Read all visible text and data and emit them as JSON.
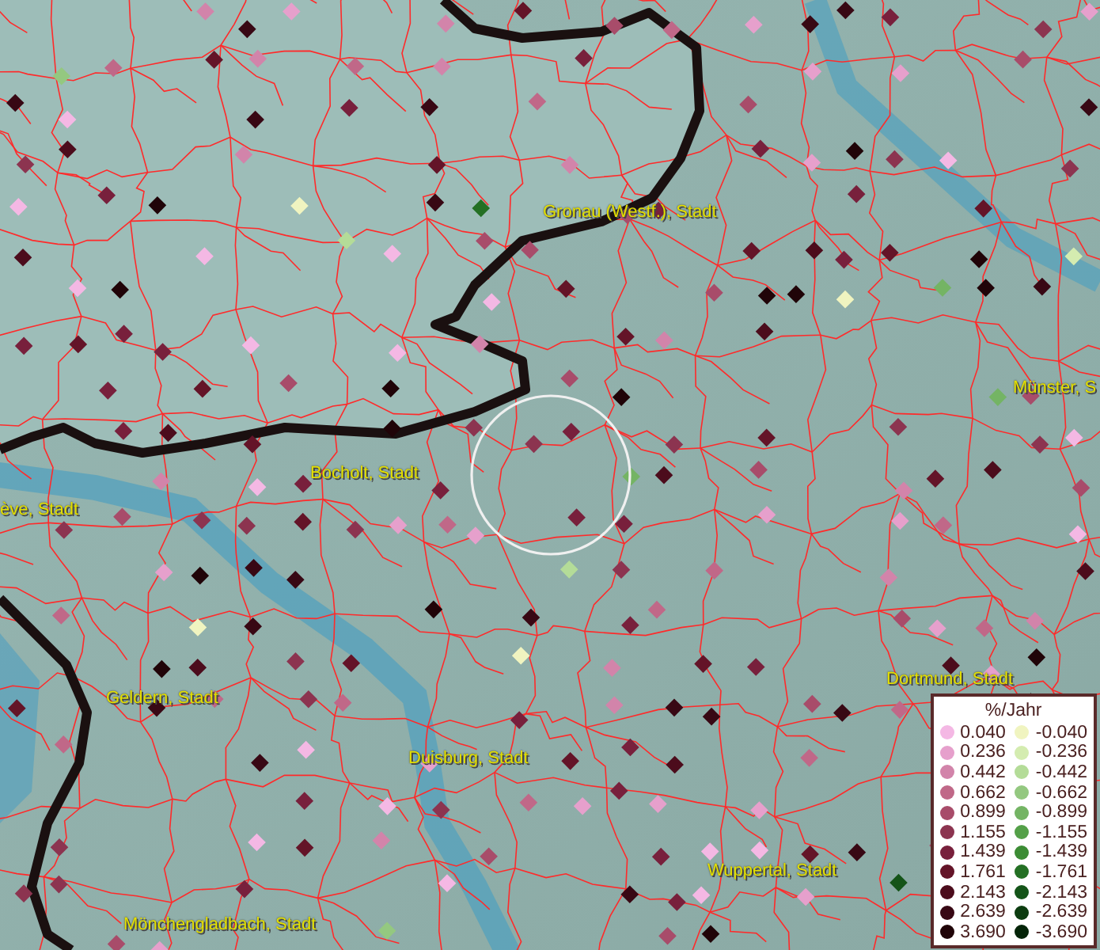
{
  "map": {
    "place_labels": [
      {
        "label": "Gronau (Westf.), Stadt"
      },
      {
        "label": "Münster, S"
      },
      {
        "label": "Bocholt, Stadt"
      },
      {
        "label": "ève, Stadt"
      },
      {
        "label": "Geldern, Stadt"
      },
      {
        "label": "Dortmund, Stadt"
      },
      {
        "label": "Duisburg, Stadt"
      },
      {
        "label": "Wuppertal, Stadt"
      },
      {
        "label": "Mönchengladbach, Stadt"
      }
    ]
  },
  "legend": {
    "title": "%/Jahr",
    "positive": [
      {
        "label": "0.040",
        "color": "#f4b8e4"
      },
      {
        "label": "0.236",
        "color": "#e6a0cc"
      },
      {
        "label": "0.442",
        "color": "#d284aa"
      },
      {
        "label": "0.662",
        "color": "#c06888"
      },
      {
        "label": "0.899",
        "color": "#a84c6a"
      },
      {
        "label": "1.155",
        "color": "#8c3450"
      },
      {
        "label": "1.439",
        "color": "#78203c"
      },
      {
        "label": "1.761",
        "color": "#641428"
      },
      {
        "label": "2.143",
        "color": "#4c0c1c"
      },
      {
        "label": "2.639",
        "color": "#380814"
      },
      {
        "label": "3.690",
        "color": "#200408"
      }
    ],
    "negative": [
      {
        "label": "-0.040",
        "color": "#f0f4c0"
      },
      {
        "label": "-0.236",
        "color": "#d4ecb0"
      },
      {
        "label": "-0.442",
        "color": "#b4dc98"
      },
      {
        "label": "-0.662",
        "color": "#94c880"
      },
      {
        "label": "-0.899",
        "color": "#74b464"
      },
      {
        "label": "-1.155",
        "color": "#54a048"
      },
      {
        "label": "-1.439",
        "color": "#3c8c34"
      },
      {
        "label": "-1.761",
        "color": "#247024"
      },
      {
        "label": "-2.143",
        "color": "#145418"
      },
      {
        "label": "-2.639",
        "color": "#0c3c10"
      },
      {
        "label": "-3.690",
        "color": "#042408"
      }
    ]
  }
}
